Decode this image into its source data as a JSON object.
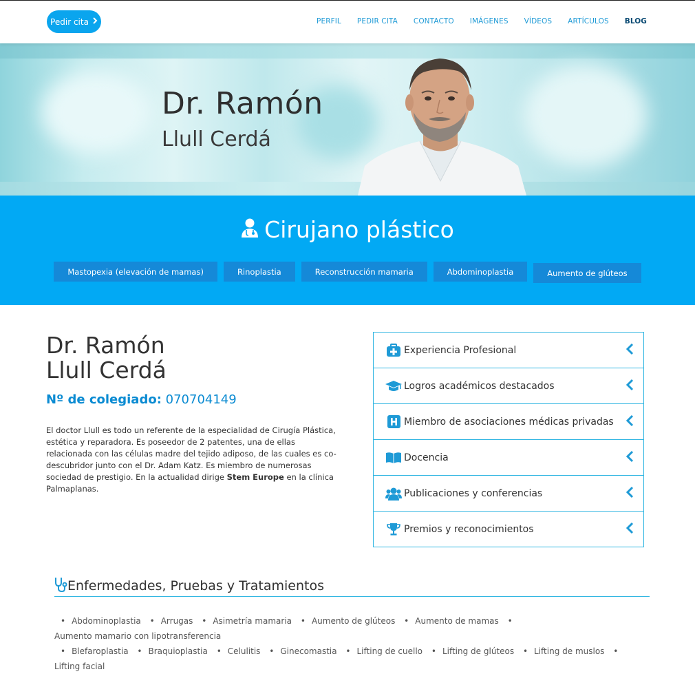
{
  "header": {
    "cta_label": "Pedir cita",
    "nav": [
      "PERFIL",
      "PEDIR CITA",
      "CONTACTO",
      "IMÁGENES",
      "VÍDEOS",
      "ARTÍCULOS",
      "BLOG"
    ]
  },
  "hero": {
    "name_line1": "Dr. Ramón",
    "name_line2": "Llull Cerdá"
  },
  "specialty": {
    "title": "Cirujano plástico",
    "tags": [
      "Mastopexia (elevación de mamas)",
      "Rinoplastia",
      "Reconstrucción mamaria",
      "Abdominoplastia",
      "Aumento de glúteos"
    ]
  },
  "profile": {
    "name_line1": "Dr. Ramón",
    "name_line2": "Llull Cerdá",
    "colegiado_label": "Nº de colegiado:",
    "colegiado_number": "070704149",
    "bio_text": "El doctor Llull es todo un referente de la especialidad de Cirugía Plástica, estética y reparadora. Es poseedor de 2 patentes, una de ellas relacionada con las células madre del tejido adiposo, de las cuales es co-descubridor junto con el Dr. Adam Katz. Es miembro de numerosas sociedad de prestigio. En la actualidad dirige",
    "bio_bold": "Stem Europe",
    "bio_end": "en la clínica Palmaplanas."
  },
  "accordion": [
    {
      "label": "Experiencia Profesional",
      "icon": "medical-kit-icon"
    },
    {
      "label": "Logros académicos destacados",
      "icon": "graduation-cap-icon"
    },
    {
      "label": "Miembro de asociaciones médicas privadas",
      "icon": "hospital-h-icon"
    },
    {
      "label": "Docencia",
      "icon": "open-book-icon"
    },
    {
      "label": "Publicaciones y conferencias",
      "icon": "users-group-icon"
    },
    {
      "label": "Premios y reconocimientos",
      "icon": "trophy-icon"
    }
  ],
  "treatments": {
    "title": "Enfermedades, Pruebas y Tratamientos",
    "row1": [
      "Abdominoplastia",
      "Arrugas",
      "Asimetría mamaria",
      "Aumento de glúteos",
      "Aumento de mamas",
      "Aumento mamario con lipotransferencia"
    ],
    "row2": [
      "Blefaroplastia",
      "Braquioplastia",
      "Celulitis",
      "Ginecomastia",
      "Lifting de cuello",
      "Lifting de glúteos",
      "Lifting de muslos",
      "Lifting facial"
    ]
  },
  "colors": {
    "accent": "#02a9f4",
    "tag_bg": "#1589d8",
    "nav": "#1e9ad6",
    "border": "#31b6e2"
  }
}
